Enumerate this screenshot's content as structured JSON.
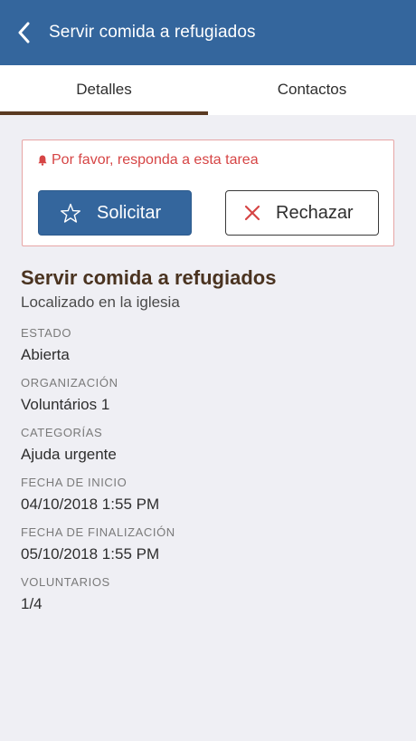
{
  "navbar": {
    "title": "Servir comida a refugiados"
  },
  "tabs": [
    {
      "label": "Detalles"
    },
    {
      "label": "Contactos"
    }
  ],
  "alert": {
    "message": "Por favor, responda a esta tarea",
    "claim_label": "Solicitar",
    "reject_label": "Rechazar"
  },
  "task": {
    "title": "Servir comida a refugiados",
    "location": "Localizado en la iglesia",
    "fields": [
      {
        "label": "ESTADO",
        "value": "Abierta"
      },
      {
        "label": "ORGANIZACIÓN",
        "value": "Voluntários 1"
      },
      {
        "label": "CATEGORÍAS",
        "value": "Ajuda urgente"
      },
      {
        "label": "FECHA DE INICIO",
        "value": "04/10/2018 1:55 PM"
      },
      {
        "label": "FECHA DE FINALIZACIÓN",
        "value": "05/10/2018 1:55 PM"
      },
      {
        "label": "VOLUNTARIOS",
        "value": "1/4"
      }
    ]
  },
  "colors": {
    "navbar": "#34669d",
    "tab_indicator": "#5a3a22",
    "alert_text": "#d64545",
    "alert_border": "#e7a5a5",
    "title_brown": "#4a3320"
  },
  "icons": {
    "back": "chevron-left-icon",
    "bell": "bell-icon",
    "star": "star-outline-icon",
    "close": "close-icon"
  }
}
